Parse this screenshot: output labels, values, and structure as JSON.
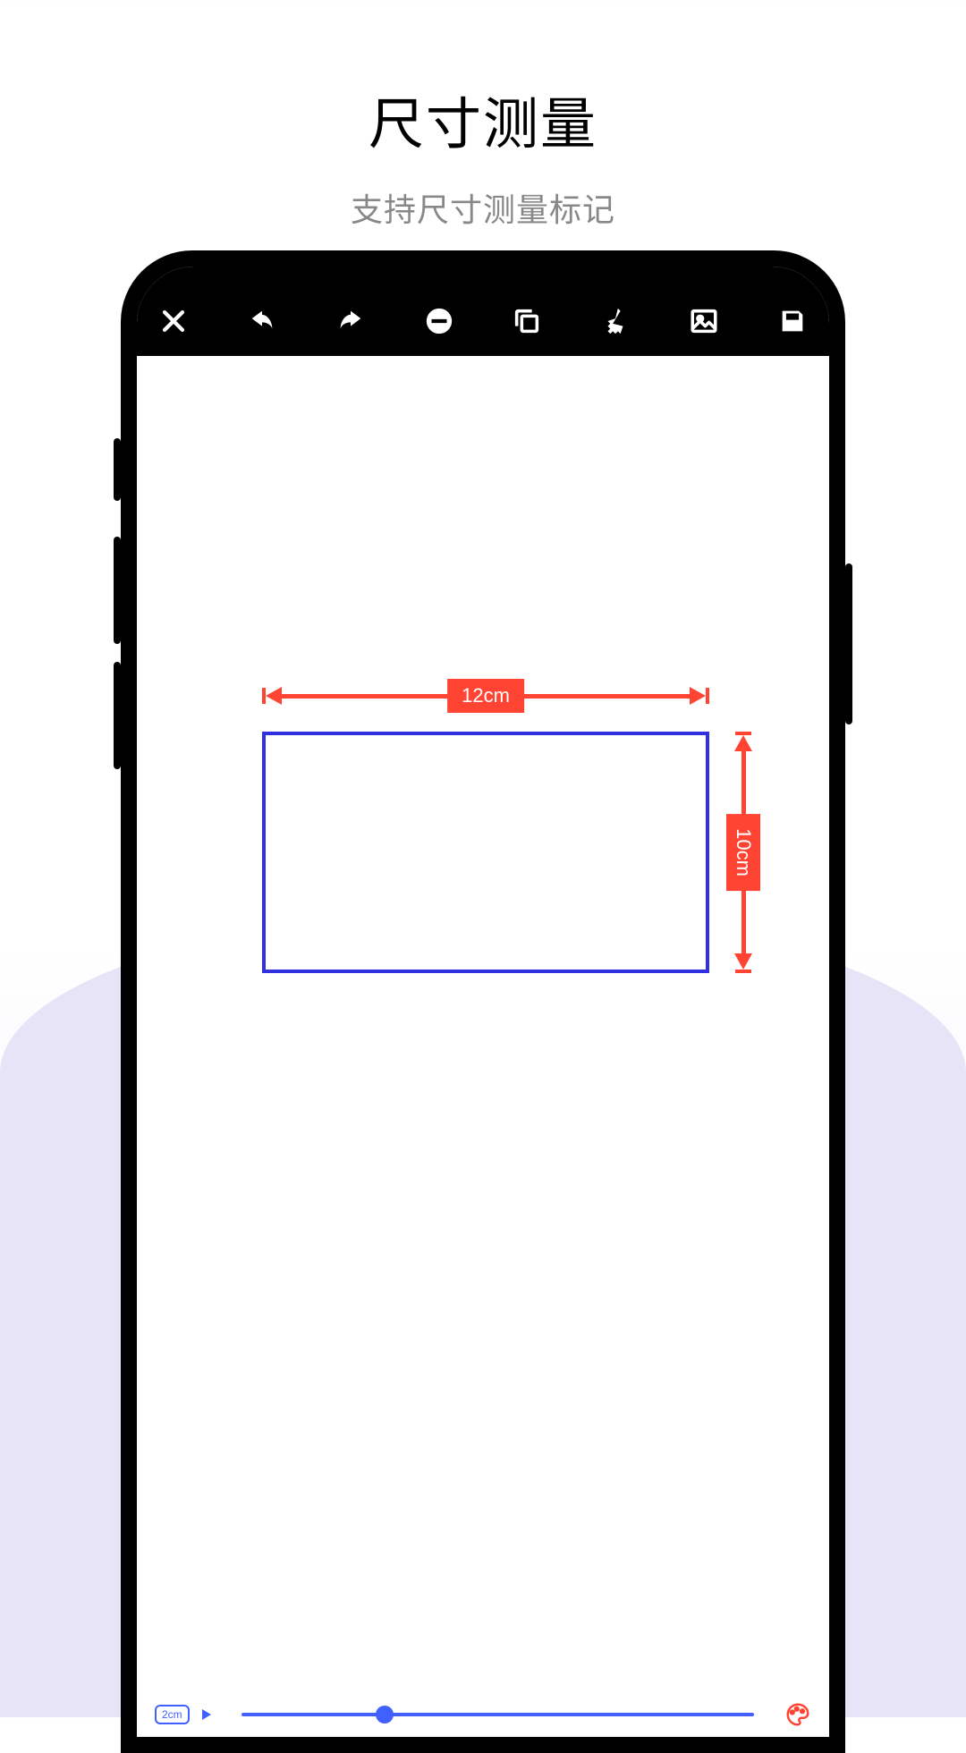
{
  "header": {
    "title": "尺寸测量",
    "subtitle": "支持尺寸测量标记"
  },
  "canvas": {
    "width_label": "12cm",
    "height_label": "10cm"
  },
  "slider": {
    "badge": "2cm"
  },
  "colors": {
    "measure": "#ff4433",
    "rect": "#3030e0",
    "accent": "#4060ff"
  }
}
